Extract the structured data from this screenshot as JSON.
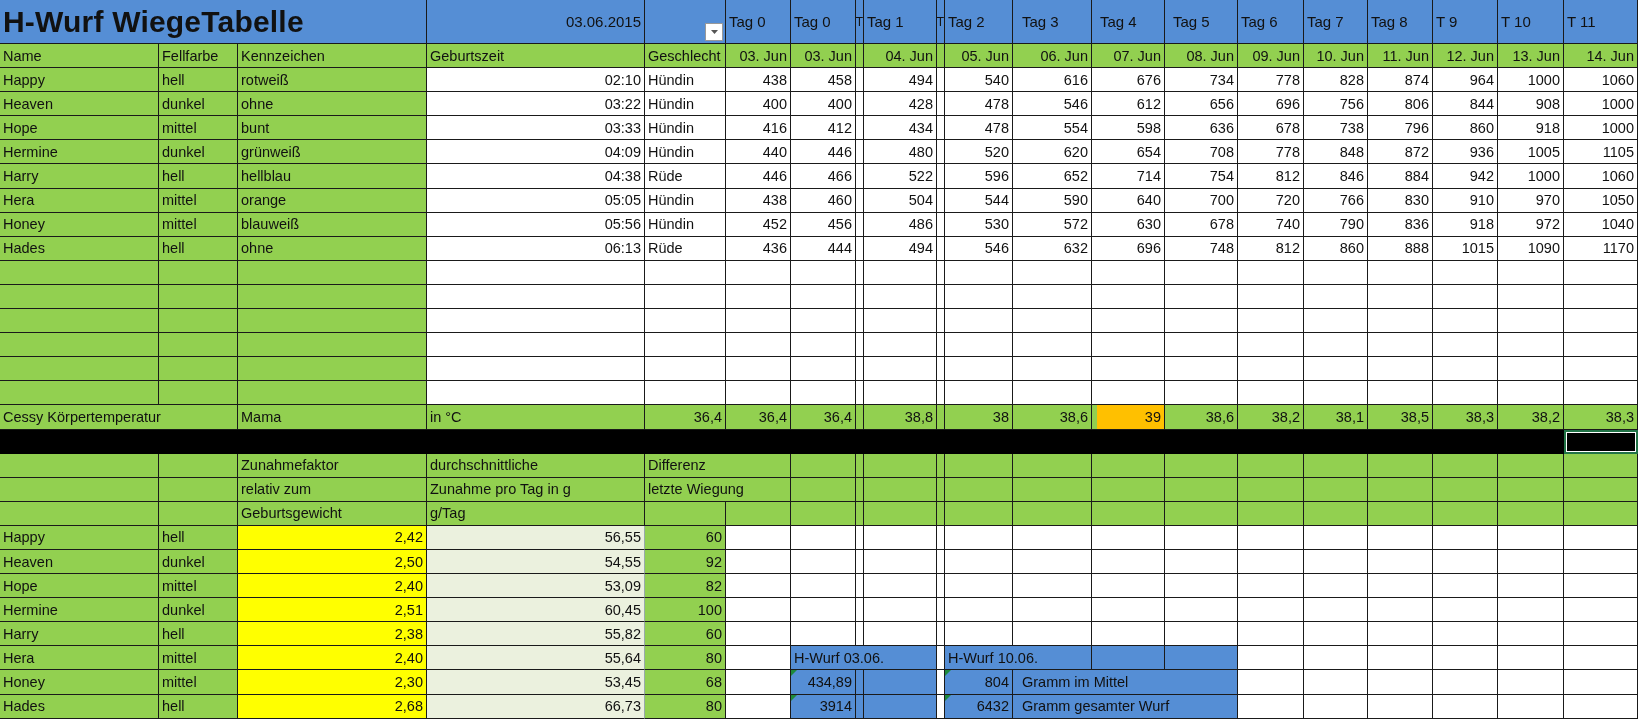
{
  "title": "H-Wurf WiegeTabelle",
  "date": "03.06.2015",
  "columns": {
    "name": "Name",
    "fur": "Fellfarbe",
    "marking": "Kennzeichen",
    "birth_time": "Geburtszeit",
    "sex": "Geschlecht"
  },
  "days": [
    {
      "label": "Tag 0",
      "date": "03. Jun"
    },
    {
      "label": "Tag 0",
      "date": "03. Jun"
    },
    {
      "label": "Tag 1",
      "date": "04. Jun"
    },
    {
      "label": "Tag 2",
      "date": "05. Jun"
    },
    {
      "label": "Tag 3",
      "date": "06. Jun"
    },
    {
      "label": "Tag 4",
      "date": "07. Jun"
    },
    {
      "label": "Tag 5",
      "date": "08. Jun"
    },
    {
      "label": "Tag 6",
      "date": "09. Jun"
    },
    {
      "label": "Tag 7",
      "date": "10. Jun"
    },
    {
      "label": "Tag 8",
      "date": "11. Jun"
    },
    {
      "label": "T 9",
      "date": "12. Jun"
    },
    {
      "label": "T 10",
      "date": "13. Jun"
    },
    {
      "label": "T 11",
      "date": "14. Jun"
    }
  ],
  "spacer_labels": [
    "T",
    "T"
  ],
  "puppies": [
    {
      "name": "Happy",
      "fur": "hell",
      "marking": "rotweiß",
      "birth_time": "02:10",
      "sex": "Hündin",
      "weights": [
        "438",
        "458",
        "494",
        "540",
        "616",
        "676",
        "734",
        "778",
        "828",
        "874",
        "964",
        "1000",
        "1060"
      ]
    },
    {
      "name": "Heaven",
      "fur": "dunkel",
      "marking": "ohne",
      "birth_time": "03:22",
      "sex": "Hündin",
      "weights": [
        "400",
        "400",
        "428",
        "478",
        "546",
        "612",
        "656",
        "696",
        "756",
        "806",
        "844",
        "908",
        "1000"
      ]
    },
    {
      "name": "Hope",
      "fur": "mittel",
      "marking": "bunt",
      "birth_time": "03:33",
      "sex": "Hündin",
      "weights": [
        "416",
        "412",
        "434",
        "478",
        "554",
        "598",
        "636",
        "678",
        "738",
        "796",
        "860",
        "918",
        "1000"
      ]
    },
    {
      "name": "Hermine",
      "fur": "dunkel",
      "marking": "grünweiß",
      "birth_time": "04:09",
      "sex": "Hündin",
      "weights": [
        "440",
        "446",
        "480",
        "520",
        "620",
        "654",
        "708",
        "778",
        "848",
        "872",
        "936",
        "1005",
        "1105"
      ]
    },
    {
      "name": "Harry",
      "fur": "hell",
      "marking": "hellblau",
      "birth_time": "04:38",
      "sex": "Rüde",
      "weights": [
        "446",
        "466",
        "522",
        "596",
        "652",
        "714",
        "754",
        "812",
        "846",
        "884",
        "942",
        "1000",
        "1060"
      ]
    },
    {
      "name": "Hera",
      "fur": "mittel",
      "marking": "orange",
      "birth_time": "05:05",
      "sex": "Hündin",
      "weights": [
        "438",
        "460",
        "504",
        "544",
        "590",
        "640",
        "700",
        "720",
        "766",
        "830",
        "910",
        "970",
        "1050"
      ]
    },
    {
      "name": "Honey",
      "fur": "mittel",
      "marking": "blauweiß",
      "birth_time": "05:56",
      "sex": "Hündin",
      "weights": [
        "452",
        "456",
        "486",
        "530",
        "572",
        "630",
        "678",
        "740",
        "790",
        "836",
        "918",
        "972",
        "1040"
      ]
    },
    {
      "name": "Hades",
      "fur": "hell",
      "marking": "ohne",
      "birth_time": "06:13",
      "sex": "Rüde",
      "weights": [
        "436",
        "444",
        "494",
        "546",
        "632",
        "696",
        "748",
        "812",
        "860",
        "888",
        "1015",
        "1090",
        "1170"
      ]
    }
  ],
  "temperature": {
    "label": "Cessy Körpertemperatur",
    "who": "Mama",
    "unit": "in °C",
    "values": [
      {
        "value": "36,4",
        "highlighted": false
      },
      {
        "value": "36,4",
        "highlighted": false
      },
      {
        "value": "36,4",
        "highlighted": false
      },
      {
        "value": "38,8",
        "highlighted": false
      },
      {
        "value": "38",
        "highlighted": false
      },
      {
        "value": "38,6",
        "highlighted": false
      },
      {
        "value": "39",
        "highlighted": true
      },
      {
        "value": "38,6",
        "highlighted": false
      },
      {
        "value": "38,2",
        "highlighted": false
      },
      {
        "value": "38,1",
        "highlighted": false
      },
      {
        "value": "38,5",
        "highlighted": false
      },
      {
        "value": "38,3",
        "highlighted": false
      },
      {
        "value": "38,2",
        "highlighted": false
      },
      {
        "value": "38,3",
        "highlighted": false
      }
    ]
  },
  "stats_headers": {
    "factor": [
      "Zunahmefaktor",
      "relativ zum",
      "Geburtsgewicht"
    ],
    "average": [
      "durchschnittliche",
      "Zunahme pro Tag in g",
      "g/Tag"
    ],
    "difference": [
      "Differenz",
      "letzte Wiegung"
    ]
  },
  "stats": [
    {
      "name": "Happy",
      "fur": "hell",
      "factor": "2,42",
      "average": "56,55",
      "difference": "60"
    },
    {
      "name": "Heaven",
      "fur": "dunkel",
      "factor": "2,50",
      "average": "54,55",
      "difference": "92"
    },
    {
      "name": "Hope",
      "fur": "mittel",
      "factor": "2,40",
      "average": "53,09",
      "difference": "82"
    },
    {
      "name": "Hermine",
      "fur": "dunkel",
      "factor": "2,51",
      "average": "60,45",
      "difference": "100"
    },
    {
      "name": "Harry",
      "fur": "hell",
      "factor": "2,38",
      "average": "55,82",
      "difference": "60"
    },
    {
      "name": "Hera",
      "fur": "mittel",
      "factor": "2,40",
      "average": "55,64",
      "difference": "80"
    },
    {
      "name": "Honey",
      "fur": "mittel",
      "factor": "2,30",
      "average": "53,45",
      "difference": "68"
    },
    {
      "name": "Hades",
      "fur": "hell",
      "factor": "2,68",
      "average": "66,73",
      "difference": "80"
    }
  ],
  "summaries": [
    {
      "title": "H-Wurf 03.06.",
      "mean": {
        "value": "434,89",
        "flagged": true
      },
      "total": {
        "value": "3914",
        "flagged": true
      }
    },
    {
      "title": "H-Wurf 10.06.",
      "mean": {
        "value": "804",
        "flagged": true
      },
      "mean_label": "Gramm im Mittel",
      "total": {
        "value": "6432",
        "flagged": true
      },
      "total_label": "Gramm gesamter Wurf"
    }
  ]
}
